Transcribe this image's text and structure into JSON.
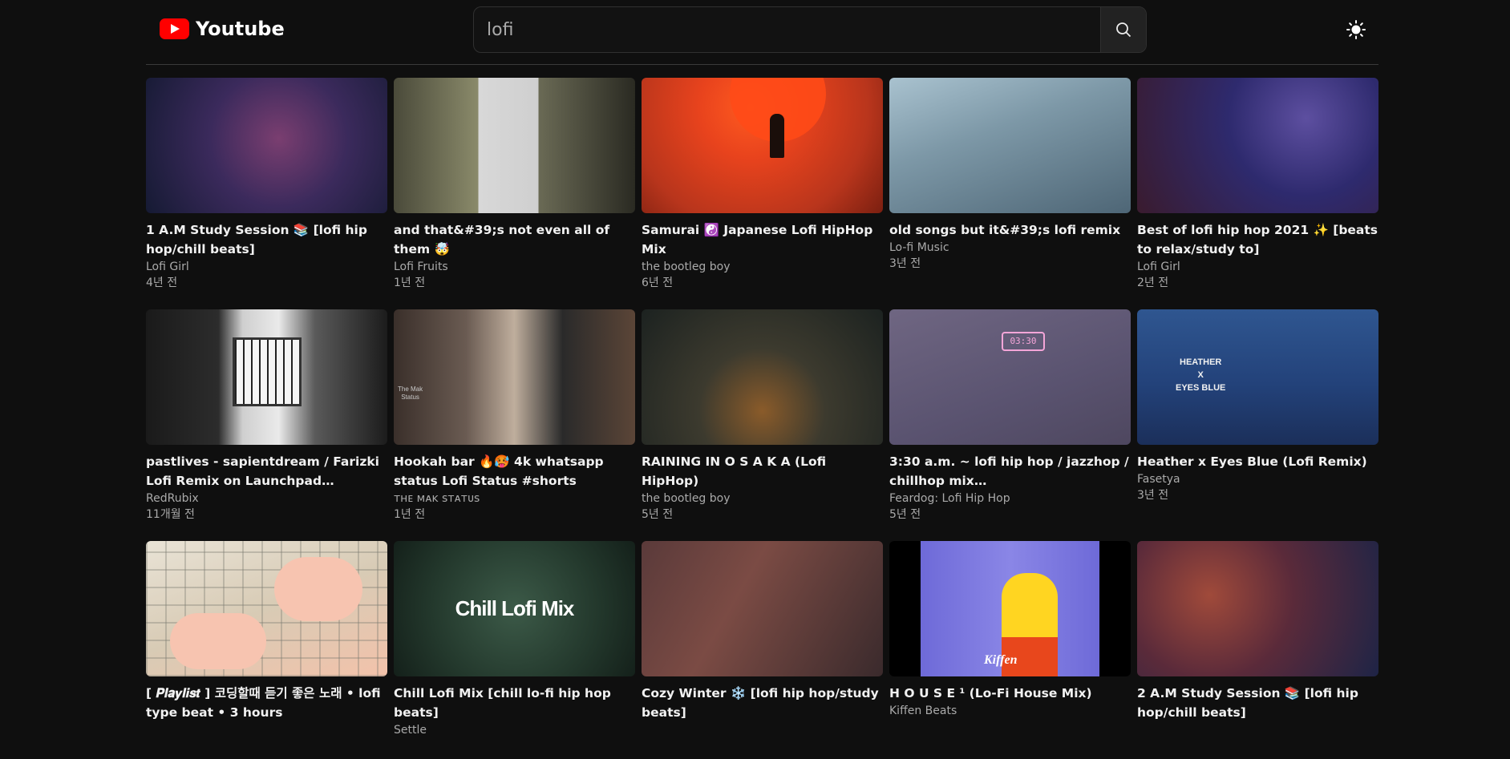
{
  "app": {
    "name": "Youtube",
    "brand_color": "#ff0000"
  },
  "search": {
    "value": "lofi",
    "icon": "search-icon"
  },
  "header": {
    "theme_icon": "sun-icon"
  },
  "videos": [
    {
      "title": "1 A.M Study Session 📚 [lofi hip hop/chill beats]",
      "channel": "Lofi Girl",
      "age": "4년 전"
    },
    {
      "title": "and that&#39;s not even all of them 🤯",
      "channel": "Lofi Fruits",
      "age": "1년 전"
    },
    {
      "title": "Samurai ☯️ Japanese Lofi HipHop Mix",
      "channel": "the bootleg boy",
      "age": "6년 전"
    },
    {
      "title": "old songs but it&#39;s lofi remix",
      "channel": "Lo-fi Music",
      "age": "3년 전"
    },
    {
      "title": "Best of lofi hip hop 2021 ✨ [beats to relax/study to]",
      "channel": "Lofi Girl",
      "age": "2년 전"
    },
    {
      "title": "pastlives - sapientdream / Farizki Lofi Remix on Launchpad #pastlives #sapientdream #launchpad",
      "channel": "RedRubix",
      "age": "11개월 전"
    },
    {
      "title": "Hookah bar 🔥🥵 4k whatsapp status Lofi Status #shorts",
      "channel": "ᴛʜᴇ ᴍᴀᴋ sᴛᴀᴛᴜs",
      "age": "1년 전"
    },
    {
      "title": "RAINING IN O S A K A (Lofi HipHop)",
      "channel": "the bootleg boy",
      "age": "5년 전"
    },
    {
      "title": "3:30 a.m. ~ lofi hip hop / jazzhop / chillhop mix [study/sleep/homework music]",
      "channel": "Feardog: Lofi Hip Hop",
      "age": "5년 전"
    },
    {
      "title": "Heather x Eyes Blue (Lofi Remix)",
      "channel": "Fasetya",
      "age": "3년 전"
    },
    {
      "title": "[ 𝑷𝒍𝒂𝒚𝒍𝒊𝒔𝒕 ] 코딩할때 듣기 좋은 노래 • lofi type beat • 3 hours",
      "channel": "",
      "age": ""
    },
    {
      "title": "Chill Lofi Mix [chill lo-fi hip hop beats]",
      "channel": "Settle",
      "age": ""
    },
    {
      "title": "Cozy Winter ❄️ [lofi hip hop/study beats]",
      "channel": "",
      "age": ""
    },
    {
      "title": "H O U S E ¹ (Lo-Fi House Mix)",
      "channel": "Kiffen Beats",
      "age": ""
    },
    {
      "title": "2 A.M Study Session 📚 [lofi hip hop/chill beats]",
      "channel": "",
      "age": ""
    }
  ],
  "thumb_text": {
    "chill_lofi_mix": "Chill Lofi Mix",
    "clock": "03:30",
    "heather": "HEATHER\nX\nEYES BLUE",
    "mak": "The Mak\nStatus",
    "kiffen": "Kiffen"
  }
}
